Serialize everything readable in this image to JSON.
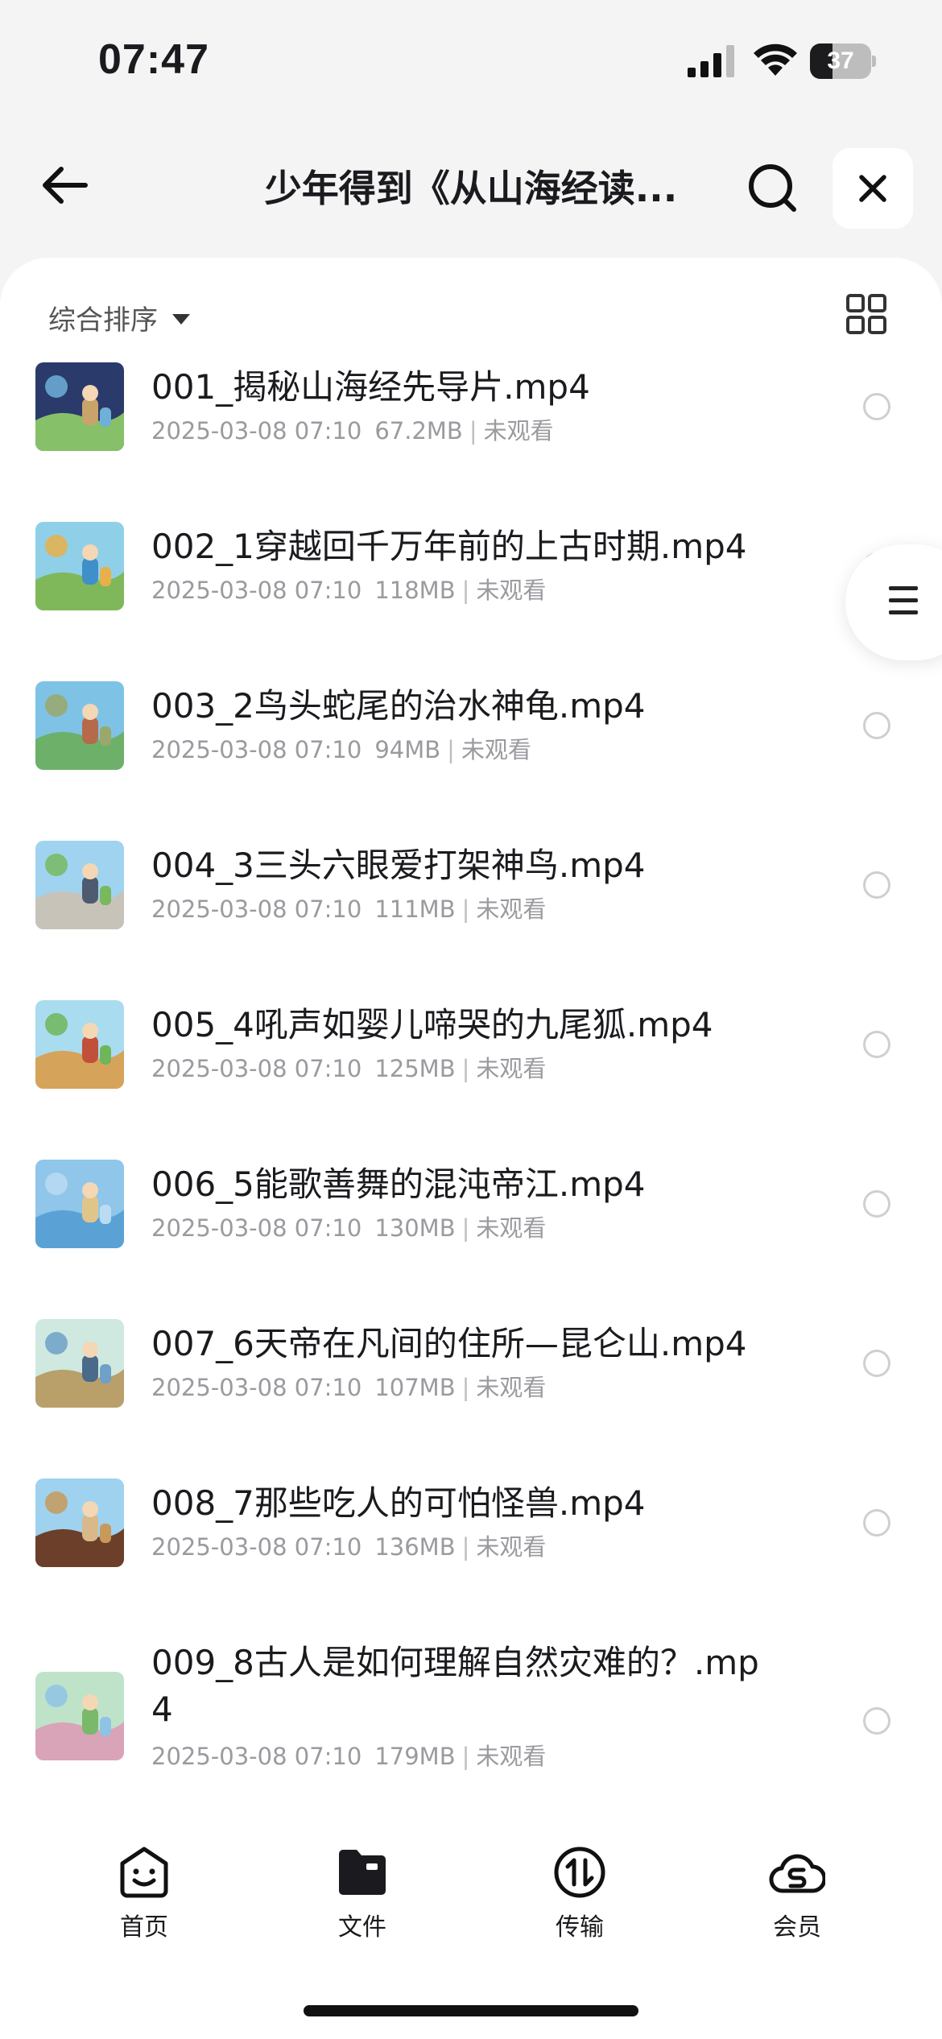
{
  "status_bar": {
    "time": "07:47",
    "battery": "37",
    "battery_level": 0.37
  },
  "header": {
    "title": "少年得到《从山海经读..."
  },
  "toolbar": {
    "sort_label": "综合排序"
  },
  "files": [
    {
      "name": "001_揭秘山海经先导片.mp4",
      "date": "2025-03-08 07:10",
      "size": "67.2MB",
      "status": "未观看",
      "colors": [
        "#2a3a6b",
        "#6fb0d8",
        "#86c068",
        "#c9a46a"
      ]
    },
    {
      "name": "002_1穿越回千万年前的上古时期.mp4",
      "date": "2025-03-08 07:10",
      "size": "118MB",
      "status": "未观看",
      "colors": [
        "#8fd0e8",
        "#e8b04a",
        "#7fb85a",
        "#3f8fc9"
      ]
    },
    {
      "name": "003_2鸟头蛇尾的治水神龟.mp4",
      "date": "2025-03-08 07:10",
      "size": "94MB",
      "status": "未观看",
      "colors": [
        "#7ec3e6",
        "#9aa86a",
        "#6db06a",
        "#b56a4a"
      ]
    },
    {
      "name": "004_3三头六眼爱打架神鸟.mp4",
      "date": "2025-03-08 07:10",
      "size": "111MB",
      "status": "未观看",
      "colors": [
        "#9fd3ef",
        "#78b85f",
        "#c7c3b9",
        "#4e5a70"
      ]
    },
    {
      "name": "005_4吼声如婴儿啼哭的九尾狐.mp4",
      "date": "2025-03-08 07:10",
      "size": "125MB",
      "status": "未观看",
      "colors": [
        "#a9dcef",
        "#6fb65a",
        "#d6a35a",
        "#c0503a"
      ]
    },
    {
      "name": "006_5能歌善舞的混沌帝江.mp4",
      "date": "2025-03-08 07:10",
      "size": "130MB",
      "status": "未观看",
      "colors": [
        "#8fc6ea",
        "#b9dcf2",
        "#5aa2d6",
        "#e0c58a"
      ]
    },
    {
      "name": "007_6天帝在凡间的住所—昆仑山.mp4",
      "date": "2025-03-08 07:10",
      "size": "107MB",
      "status": "未观看",
      "colors": [
        "#cfe9e0",
        "#6fa0c8",
        "#b9a06a",
        "#4a6a8a"
      ]
    },
    {
      "name": "008_7那些吃人的可怕怪兽.mp4",
      "date": "2025-03-08 07:10",
      "size": "136MB",
      "status": "未观看",
      "colors": [
        "#9fd2ef",
        "#c79a5a",
        "#6b3f2a",
        "#d9b98a"
      ]
    },
    {
      "name": "009_8古人是如何理解自然灾难的？.mp4",
      "date": "2025-03-08 07:10",
      "size": "179MB",
      "status": "未观看",
      "colors": [
        "#bfe3c8",
        "#8fc3e6",
        "#d9a3b8",
        "#7ab86a"
      ]
    }
  ],
  "bottom_nav": [
    {
      "label": "首页",
      "icon": "home-face-icon"
    },
    {
      "label": "文件",
      "icon": "folder-icon"
    },
    {
      "label": "传输",
      "icon": "transfer-icon"
    },
    {
      "label": "会员",
      "icon": "vip-cloud-icon"
    }
  ]
}
